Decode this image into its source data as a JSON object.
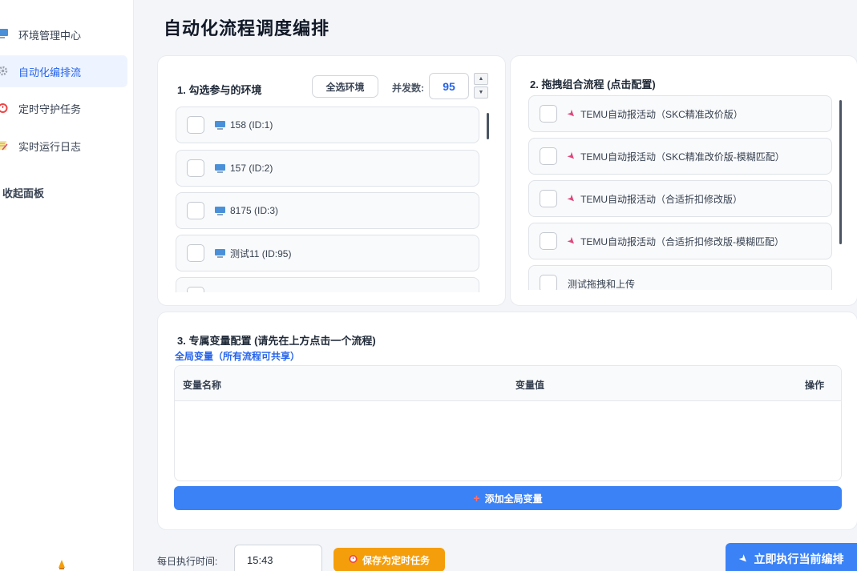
{
  "sidebar": {
    "items": [
      {
        "icon": "monitor-icon",
        "label": "环境管理中心",
        "active": false
      },
      {
        "icon": "gear-icon",
        "label": "自动化编排流",
        "active": true
      },
      {
        "icon": "alarm-clock-icon",
        "label": "定时守护任务",
        "active": false
      },
      {
        "icon": "memo-icon",
        "label": "实时运行日志",
        "active": false
      }
    ],
    "collapse_label": "收起面板"
  },
  "page_title": "自动化流程调度编排",
  "env_section": {
    "title": "1. 勾选参与的环境",
    "select_all_label": "全选环境",
    "concurrency_label": "并发数:",
    "concurrency_value": "95",
    "environments": [
      {
        "label": "158 (ID:1)"
      },
      {
        "label": "157 (ID:2)"
      },
      {
        "label": "8175 (ID:3)"
      },
      {
        "label": "测试11 (ID:95)"
      }
    ]
  },
  "flow_section": {
    "title": "2. 拖拽组合流程 (点击配置)",
    "flows": [
      {
        "label": "TEMU自动报活动（SKC精准改价版）",
        "icon": "rocket-icon"
      },
      {
        "label": "TEMU自动报活动（SKC精准改价版-模糊匹配）",
        "icon": "rocket-icon"
      },
      {
        "label": "TEMU自动报活动（合适折扣修改版）",
        "icon": "rocket-icon"
      },
      {
        "label": "TEMU自动报活动（合适折扣修改版-模糊匹配）",
        "icon": "rocket-icon"
      },
      {
        "label": "测试拖拽和上传",
        "icon": ""
      }
    ]
  },
  "var_section": {
    "title": "3. 专属变量配置 (请先在上方点击一个流程)",
    "global_label": "全局变量（所有流程可共享）",
    "columns": {
      "name": "变量名称",
      "value": "变量值",
      "action": "操作"
    },
    "add_label": "添加全局变量"
  },
  "footer": {
    "daily_label": "每日执行时间:",
    "time_value": "15:43",
    "save_label": "保存为定时任务",
    "run_label": "立即执行当前编排"
  },
  "colors": {
    "accent": "#3b82f6",
    "warning": "#f59e0b",
    "active_bg": "#eef4ff"
  }
}
